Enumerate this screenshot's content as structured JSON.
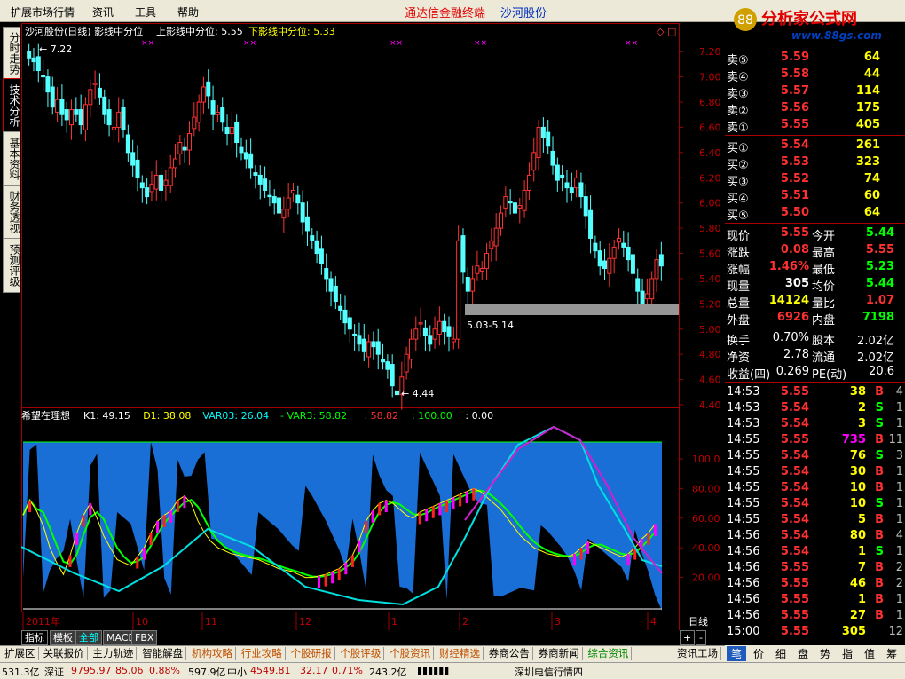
{
  "menu": {
    "items": [
      "扩展市场行情",
      "资讯",
      "工具",
      "帮助"
    ],
    "center_title": "通达信金融终端",
    "stock_name": "沙河股份",
    "logo_text": "分析家公式网",
    "logo_url": "www.88gs.com"
  },
  "side_tabs": [
    "分时走势",
    "技术分析",
    "基本资料",
    "财务透视",
    "预测评级"
  ],
  "main_chart": {
    "header": "沙河股份(日线) 影线中分位",
    "upper_label": "上影线中分位: 5.55",
    "lower_label": "下影线中分位: 5.33",
    "annot_high": "7.22",
    "annot_low": "4.44",
    "annot_band": "5.03-5.14",
    "y_ticks": [
      "7.20",
      "7.00",
      "6.80",
      "6.60",
      "6.40",
      "6.20",
      "6.00",
      "5.80",
      "5.60",
      "5.40",
      "5.20",
      "5.00",
      "4.80",
      "4.60",
      "4.40"
    ],
    "colors": {
      "up": "#ff3232",
      "down": "#54ffff",
      "band": "#969696"
    }
  },
  "chart_data": {
    "type": "candlestick",
    "x_labels": [
      "2011年",
      "10",
      "11",
      "12",
      "1",
      "2",
      "3",
      "4"
    ],
    "y_range": [
      4.4,
      7.3
    ],
    "close_series": [
      7.15,
      7.12,
      7.05,
      7.0,
      6.88,
      6.76,
      6.82,
      6.7,
      6.66,
      6.74,
      6.7,
      6.62,
      6.78,
      6.9,
      6.95,
      6.84,
      6.7,
      6.62,
      6.6,
      6.72,
      6.58,
      6.4,
      6.3,
      6.2,
      6.12,
      6.05,
      6.15,
      6.22,
      6.1,
      6.18,
      6.28,
      6.35,
      6.48,
      6.42,
      6.55,
      6.68,
      6.8,
      6.92,
      6.85,
      6.7,
      6.72,
      6.64,
      6.55,
      6.6,
      6.48,
      6.4,
      6.35,
      6.28,
      6.22,
      6.15,
      6.1,
      6.05,
      6.0,
      5.92,
      5.95,
      6.04,
      6.1,
      6.0,
      5.85,
      5.78,
      5.7,
      5.6,
      5.52,
      5.4,
      5.3,
      5.22,
      5.15,
      5.05,
      5.0,
      4.95,
      4.88,
      4.82,
      4.9,
      4.86,
      4.8,
      4.74,
      4.68,
      4.55,
      4.48,
      4.62,
      4.8,
      4.92,
      5.0,
      5.05,
      4.95,
      4.88,
      5.0,
      5.06,
      4.98,
      4.94,
      4.92,
      5.7,
      5.45,
      5.3,
      5.4,
      5.5,
      5.48,
      5.6,
      5.7,
      5.8,
      5.92,
      6.05,
      6.0,
      5.92,
      5.98,
      6.1,
      6.22,
      6.4,
      6.6,
      6.52,
      6.45,
      6.3,
      6.18,
      6.2,
      6.12,
      6.08,
      6.2,
      6.05,
      5.9,
      5.72,
      5.62,
      5.5,
      5.48,
      5.56,
      5.65,
      5.72,
      5.65,
      5.55,
      5.44,
      5.3,
      5.2,
      5.28,
      5.4,
      5.55,
      5.5
    ]
  },
  "indicator": {
    "name": "希望在理想",
    "values": [
      {
        "label": "K1: 49.15",
        "color": "#ffffff"
      },
      {
        "label": "D1: 38.08",
        "color": "#ffff00"
      },
      {
        "label": "VAR03: 26.04",
        "color": "#00ffff"
      },
      {
        "label": "- VAR3: 58.82",
        "color": "#00ff00"
      },
      {
        "label": ": 58.82",
        "color": "#ff3030"
      },
      {
        "label": ": 100.00",
        "color": "#00ff00"
      },
      {
        "label": ": 0.00",
        "color": "#ffffff"
      }
    ],
    "y_ticks": [
      "100.0",
      "80.00",
      "60.00",
      "40.00",
      "20.00"
    ],
    "k_series": [
      62,
      72,
      65,
      55,
      40,
      30,
      22,
      35,
      50,
      62,
      70,
      60,
      48,
      40,
      32,
      30,
      28,
      34,
      40,
      50,
      58,
      62,
      65,
      72,
      75,
      70,
      58,
      50,
      44,
      40,
      38,
      36,
      35,
      34,
      33,
      32,
      30,
      28,
      26,
      25,
      24,
      22,
      20,
      20,
      21,
      22,
      24,
      26,
      30,
      35,
      45,
      58,
      65,
      70,
      72,
      70,
      66,
      62,
      60,
      64,
      66,
      68,
      70,
      72,
      74,
      76,
      78,
      80,
      78,
      74,
      70,
      66,
      60,
      54,
      48,
      44,
      40,
      38,
      36,
      35,
      34,
      34,
      36,
      40,
      44,
      42,
      40,
      38,
      36,
      34,
      36,
      40,
      46,
      50,
      56
    ]
  },
  "quote": {
    "asks": [
      {
        "label": "卖⑤",
        "price": "5.59",
        "vol": "64"
      },
      {
        "label": "卖④",
        "price": "5.58",
        "vol": "44"
      },
      {
        "label": "卖③",
        "price": "5.57",
        "vol": "114"
      },
      {
        "label": "卖②",
        "price": "5.56",
        "vol": "175"
      },
      {
        "label": "卖①",
        "price": "5.55",
        "vol": "405"
      }
    ],
    "bids": [
      {
        "label": "买①",
        "price": "5.54",
        "vol": "261"
      },
      {
        "label": "买②",
        "price": "5.53",
        "vol": "323"
      },
      {
        "label": "买③",
        "price": "5.52",
        "vol": "74"
      },
      {
        "label": "买④",
        "price": "5.51",
        "vol": "60"
      },
      {
        "label": "买⑤",
        "price": "5.50",
        "vol": "64"
      }
    ],
    "stats": [
      {
        "l1": "现价",
        "v1": "5.55",
        "c1": "#ff3030",
        "l2": "今开",
        "v2": "5.44",
        "c2": "#00ff00"
      },
      {
        "l1": "涨跌",
        "v1": "0.08",
        "c1": "#ff3030",
        "l2": "最高",
        "v2": "5.55",
        "c2": "#ff3030"
      },
      {
        "l1": "涨幅",
        "v1": "1.46%",
        "c1": "#ff3030",
        "l2": "最低",
        "v2": "5.23",
        "c2": "#00ff00"
      },
      {
        "l1": "现量",
        "v1": "305",
        "c1": "#ffffff",
        "l2": "均价",
        "v2": "5.44",
        "c2": "#00ff00"
      },
      {
        "l1": "总量",
        "v1": "14124",
        "c1": "#ffff00",
        "l2": "量比",
        "v2": "1.07",
        "c2": "#ff3030"
      },
      {
        "l1": "外盘",
        "v1": "6926",
        "c1": "#ff3030",
        "l2": "内盘",
        "v2": "7198",
        "c2": "#00ff00"
      }
    ],
    "fundamentals": [
      {
        "l1": "换手",
        "v1": "0.70%",
        "l2": "股本",
        "v2": "2.02亿"
      },
      {
        "l1": "净资",
        "v1": "2.78",
        "l2": "流通",
        "v2": "2.02亿"
      },
      {
        "l1": "收益(四)",
        "v1": "0.269",
        "l2": "PE(动)",
        "v2": "20.6"
      }
    ],
    "ticks": [
      {
        "t": "14:53",
        "p": "5.55",
        "pc": "#ff3030",
        "v": "38",
        "vc": "#ffff00",
        "s": "B",
        "sc": "#ff3030",
        "n": "4"
      },
      {
        "t": "14:53",
        "p": "5.54",
        "pc": "#ff3030",
        "v": "2",
        "vc": "#ffff00",
        "s": "S",
        "sc": "#00ff00",
        "n": "1"
      },
      {
        "t": "14:53",
        "p": "5.54",
        "pc": "#ff3030",
        "v": "3",
        "vc": "#ffff00",
        "s": "S",
        "sc": "#00ff00",
        "n": "1"
      },
      {
        "t": "14:55",
        "p": "5.55",
        "pc": "#ff3030",
        "v": "735",
        "vc": "#ff00ff",
        "s": "B",
        "sc": "#ff3030",
        "n": "11"
      },
      {
        "t": "14:55",
        "p": "5.54",
        "pc": "#ff3030",
        "v": "76",
        "vc": "#ffff00",
        "s": "S",
        "sc": "#00ff00",
        "n": "3"
      },
      {
        "t": "14:55",
        "p": "5.54",
        "pc": "#ff3030",
        "v": "30",
        "vc": "#ffff00",
        "s": "B",
        "sc": "#ff3030",
        "n": "1"
      },
      {
        "t": "14:55",
        "p": "5.54",
        "pc": "#ff3030",
        "v": "10",
        "vc": "#ffff00",
        "s": "B",
        "sc": "#ff3030",
        "n": "1"
      },
      {
        "t": "14:55",
        "p": "5.54",
        "pc": "#ff3030",
        "v": "10",
        "vc": "#ffff00",
        "s": "S",
        "sc": "#00ff00",
        "n": "1"
      },
      {
        "t": "14:55",
        "p": "5.54",
        "pc": "#ff3030",
        "v": "5",
        "vc": "#ffff00",
        "s": "B",
        "sc": "#ff3030",
        "n": "1"
      },
      {
        "t": "14:56",
        "p": "5.54",
        "pc": "#ff3030",
        "v": "80",
        "vc": "#ffff00",
        "s": "B",
        "sc": "#ff3030",
        "n": "4"
      },
      {
        "t": "14:56",
        "p": "5.54",
        "pc": "#ff3030",
        "v": "1",
        "vc": "#ffff00",
        "s": "S",
        "sc": "#00ff00",
        "n": "1"
      },
      {
        "t": "14:56",
        "p": "5.55",
        "pc": "#ff3030",
        "v": "7",
        "vc": "#ffff00",
        "s": "B",
        "sc": "#ff3030",
        "n": "2"
      },
      {
        "t": "14:56",
        "p": "5.55",
        "pc": "#ff3030",
        "v": "46",
        "vc": "#ffff00",
        "s": "B",
        "sc": "#ff3030",
        "n": "2"
      },
      {
        "t": "14:56",
        "p": "5.55",
        "pc": "#ff3030",
        "v": "1",
        "vc": "#ffff00",
        "s": "B",
        "sc": "#ff3030",
        "n": "1"
      },
      {
        "t": "14:56",
        "p": "5.55",
        "pc": "#ff3030",
        "v": "27",
        "vc": "#ffff00",
        "s": "B",
        "sc": "#ff3030",
        "n": "1"
      },
      {
        "t": "15:00",
        "p": "5.55",
        "pc": "#ff3030",
        "v": "305",
        "vc": "#ffff00",
        "s": "",
        "sc": "#ffffff",
        "n": "12"
      }
    ]
  },
  "period_label": "日线",
  "chart_tabs": [
    "指标",
    "模板",
    "全部",
    "MACD",
    "FBX"
  ],
  "fn_tabs": [
    {
      "label": "扩展区",
      "style": ""
    },
    {
      "label": "关联报价",
      "style": ""
    },
    {
      "label": "主力轨迹",
      "style": ""
    },
    {
      "label": "智能解盘",
      "style": ""
    },
    {
      "label": "机构攻略",
      "style": "orange"
    },
    {
      "label": "行业攻略",
      "style": "orange"
    },
    {
      "label": "个股研报",
      "style": "orange"
    },
    {
      "label": "个股评级",
      "style": "orange"
    },
    {
      "label": "个股资讯",
      "style": "orange"
    },
    {
      "label": "财经精选",
      "style": "orange"
    },
    {
      "label": "券商公告",
      "style": ""
    },
    {
      "label": "券商新闻",
      "style": ""
    },
    {
      "label": "综合资讯",
      "style": "green"
    },
    {
      "label": "资讯工场",
      "style": ""
    }
  ],
  "right_tabs": [
    "笔",
    "价",
    "细",
    "盘",
    "势",
    "指",
    "值",
    "筹"
  ],
  "status": {
    "seg1": "531.3亿",
    "seg2": "深证",
    "seg3": "9795.97",
    "seg4": "85.06",
    "seg5": "0.88%",
    "seg6": "597.9亿",
    "seg7": "中小",
    "seg8": "4549.81",
    "seg9": "32.17",
    "seg10": "0.71%",
    "seg11": "243.2亿",
    "seg12": "深圳电信行情四"
  }
}
